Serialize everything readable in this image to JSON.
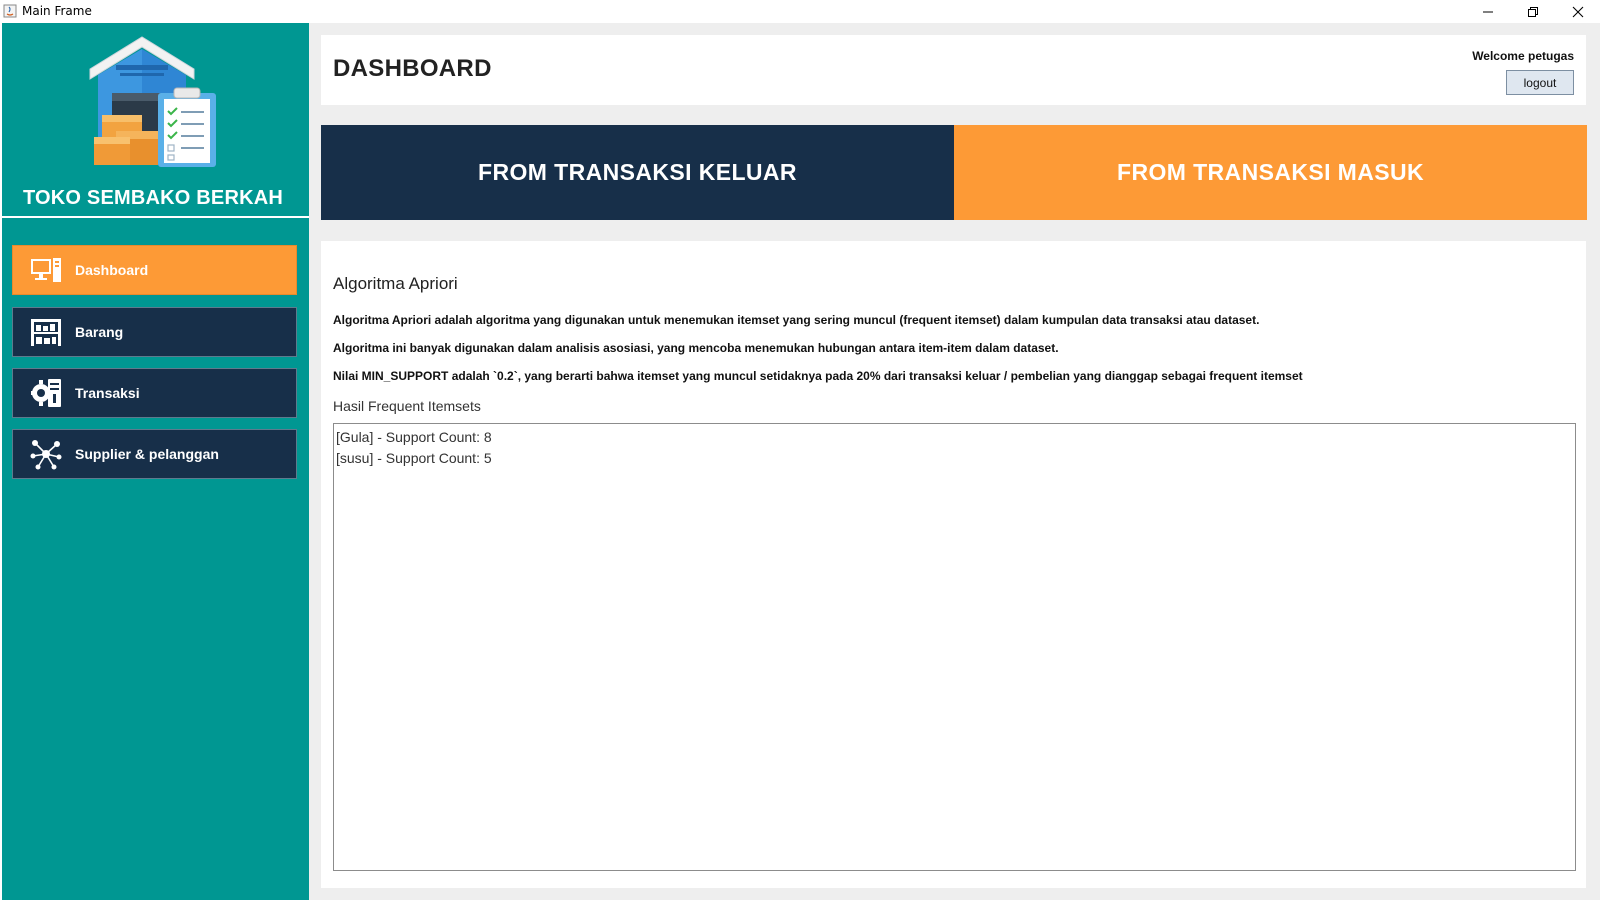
{
  "window": {
    "title": "Main Frame"
  },
  "sidebar": {
    "brand": "TOKO SEMBAKO BERKAH",
    "items": [
      {
        "label": "Dashboard",
        "icon": "dashboard-icon",
        "active": true
      },
      {
        "label": "Barang",
        "icon": "warehouse-icon",
        "active": false
      },
      {
        "label": "Transaksi",
        "icon": "transaction-icon",
        "active": false
      },
      {
        "label": "Supplier & pelanggan",
        "icon": "network-icon",
        "active": false
      }
    ]
  },
  "header": {
    "title": "DASHBOARD",
    "welcome": "Welcome petugas",
    "logout_label": "logout"
  },
  "banners": {
    "keluar": "FROM TRANSAKSI KELUAR",
    "masuk": "FROM TRANSAKSI MASUK"
  },
  "content": {
    "section_title": "Algoritma Apriori",
    "paragraphs": [
      "Algoritma Apriori adalah algoritma yang digunakan untuk menemukan itemset yang sering muncul (frequent itemset) dalam kumpulan data transaksi atau dataset.",
      "Algoritma ini banyak digunakan dalam analisis asosiasi, yang mencoba menemukan hubungan antara item-item dalam dataset.",
      "Nilai  MIN_SUPPORT adalah  `0.2`, yang berarti bahwa itemset yang muncul setidaknya pada 20%  dari transaksi keluar / pembelian yang dianggap sebagai frequent itemset"
    ],
    "result_label": "Hasil Frequent Itemsets",
    "results": [
      "[Gula] - Support Count: 8",
      "[susu] - Support Count: 5"
    ]
  },
  "colors": {
    "sidebar_bg": "#009792",
    "navy": "#172f49",
    "orange": "#fd9a36",
    "main_bg": "#eeeeee"
  }
}
